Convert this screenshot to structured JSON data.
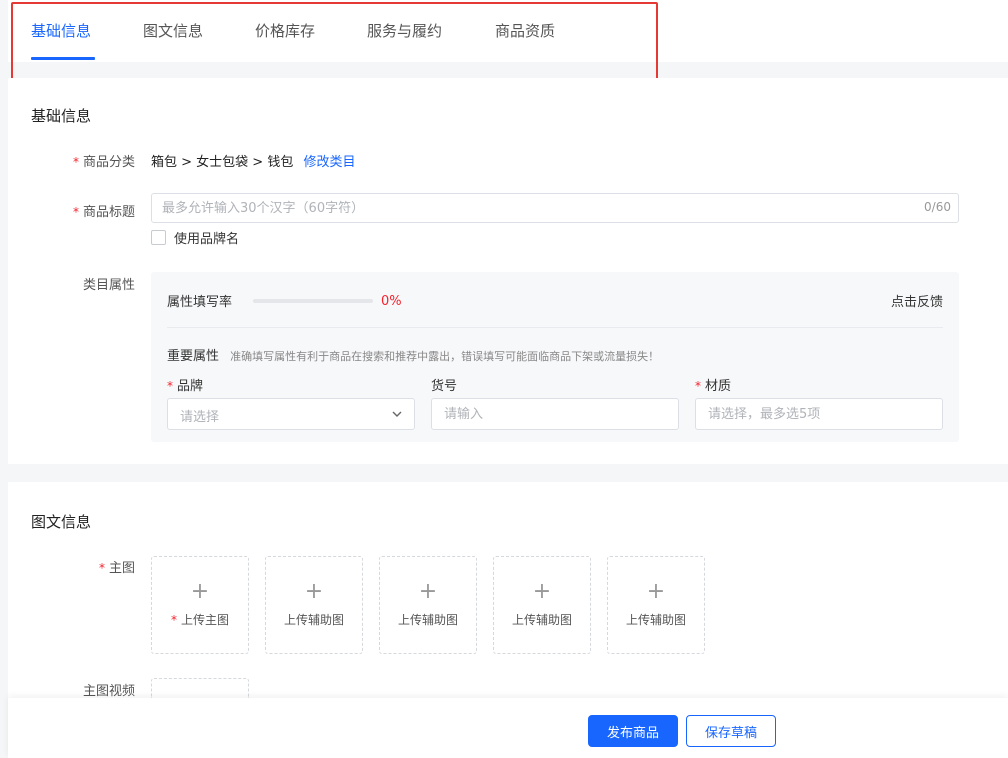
{
  "tabs": [
    {
      "label": "基础信息"
    },
    {
      "label": "图文信息"
    },
    {
      "label": "价格库存"
    },
    {
      "label": "服务与履约"
    },
    {
      "label": "商品资质"
    }
  ],
  "basic": {
    "title": "基础信息",
    "category": {
      "label": "商品分类",
      "value": "箱包 > 女士包袋 > 钱包",
      "edit_link": "修改类目"
    },
    "product_title": {
      "label": "商品标题",
      "placeholder": "最多允许输入30个汉字（60字符）",
      "counter": "0/60"
    },
    "brand_checkbox": {
      "label": "使用品牌名"
    },
    "attributes": {
      "label": "类目属性",
      "fill_rate_label": "属性填写率",
      "fill_rate": "0%",
      "fill_rate_value": 0,
      "feedback": "点击反馈",
      "important_title": "重要属性",
      "important_tip": "准确填写属性有利于商品在搜索和推荐中露出，错误填写可能面临商品下架或流量损失！",
      "fields": [
        {
          "label": "品牌",
          "placeholder": "请选择",
          "required": true
        },
        {
          "label": "货号",
          "placeholder": "请输入",
          "required": false
        },
        {
          "label": "材质",
          "placeholder": "请选择，最多选5项",
          "required": true
        }
      ]
    }
  },
  "media": {
    "title": "图文信息",
    "main_image_label": "主图",
    "tiles": [
      {
        "label": "上传主图",
        "required": true
      },
      {
        "label": "上传辅助图"
      },
      {
        "label": "上传辅助图"
      },
      {
        "label": "上传辅助图"
      },
      {
        "label": "上传辅助图"
      }
    ],
    "video_label": "主图视频"
  },
  "footer": {
    "publish": "发布商品",
    "save_draft": "保存草稿"
  },
  "colors": {
    "accent": "#1966ff",
    "required": "#f5222d",
    "highlight": "#e53935"
  }
}
